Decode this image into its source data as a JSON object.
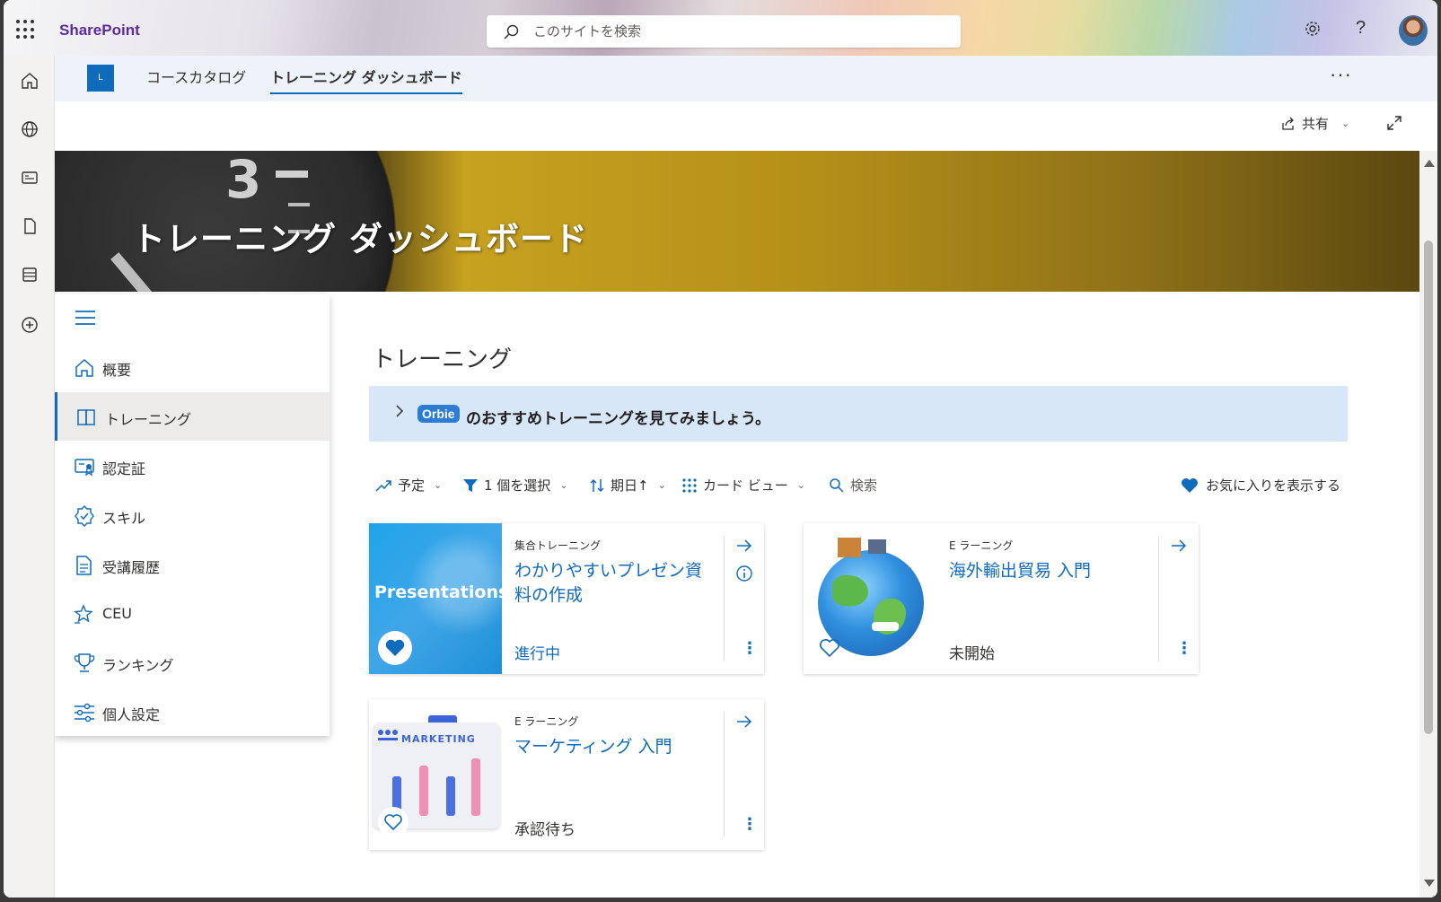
{
  "suite": {
    "brand": "SharePoint",
    "search_placeholder": "このサイトを検索"
  },
  "sitebar": {
    "logo_letter": "L",
    "tabs": [
      {
        "label": "コースカタログ"
      },
      {
        "label": "トレーニング ダッシュボード"
      }
    ],
    "more": "···"
  },
  "commandbar": {
    "share_label": "共有"
  },
  "hero": {
    "title": "トレーニング ダッシュボード"
  },
  "nav": {
    "items": [
      {
        "label": "概要",
        "icon": "home-icon"
      },
      {
        "label": "トレーニング",
        "icon": "book-icon"
      },
      {
        "label": "認定証",
        "icon": "certificate-icon"
      },
      {
        "label": "スキル",
        "icon": "skill-badge-icon"
      },
      {
        "label": "受講履歴",
        "icon": "history-document-icon"
      },
      {
        "label": "CEU",
        "icon": "star-list-icon"
      },
      {
        "label": "ランキング",
        "icon": "trophy-icon"
      },
      {
        "label": "個人設定",
        "icon": "settings-sliders-icon"
      }
    ]
  },
  "main": {
    "title": "トレーニング",
    "banner": {
      "badge": "Orbie",
      "text": "のおすすめトレーニングを見てみましょう。"
    },
    "filters": {
      "schedule": "予定",
      "select": "1 個を選択",
      "due": "期日↑",
      "view": "カード ビュー",
      "search": "検索",
      "favorites": "お気に入りを表示する"
    },
    "cards": [
      {
        "type": "集合トレーニング",
        "title": "わかりやすいプレゼン資料の作成",
        "status": "進行中",
        "thumb_text": "Presentations",
        "favorite": true
      },
      {
        "type": "E ラーニング",
        "title": "海外輸出貿易 入門",
        "status": "未開始",
        "favorite": false
      },
      {
        "type": "E ラーニング",
        "title": "マーケティング 入門",
        "status": "承認待ち",
        "thumb_text": "MARKETING",
        "favorite": false
      }
    ]
  },
  "colors": {
    "accent": "#0f6cbd",
    "brand": "#5a2ca0",
    "banner_bg": "#d7e7f7"
  }
}
